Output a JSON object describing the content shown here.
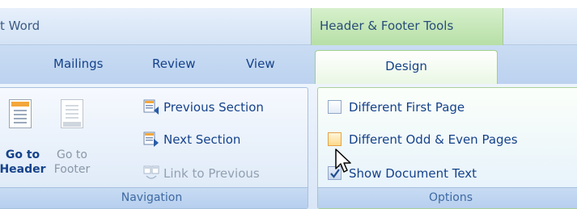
{
  "window": {
    "app_title": "t Word",
    "contextual_group_label": "Header & Footer Tools"
  },
  "tabs": {
    "mailings": "Mailings",
    "review": "Review",
    "view": "View",
    "design": "Design"
  },
  "navigation_group": {
    "caption": "Navigation",
    "go_to_header": {
      "line1": "Go to",
      "line2": "Header"
    },
    "go_to_footer": {
      "line1": "Go to",
      "line2": "Footer"
    },
    "previous_section": "Previous Section",
    "next_section": "Next Section",
    "link_to_previous": "Link to Previous"
  },
  "options_group": {
    "caption": "Options",
    "different_first_page": {
      "label": "Different First Page",
      "checked": false
    },
    "different_odd_even": {
      "label": "Different Odd & Even Pages",
      "checked": false
    },
    "show_document_text": {
      "label": "Show Document Text",
      "checked": true
    }
  },
  "colors": {
    "label_text": "#15428b",
    "contextual_tab": "#b7dfa6",
    "ribbon_bg": "#dbe8f7",
    "icon_accent": "#f3a73a"
  },
  "icons": [
    "go-to-header-icon",
    "go-to-footer-icon",
    "previous-section-icon",
    "next-section-icon",
    "link-to-previous-icon",
    "mouse-cursor-icon"
  ]
}
